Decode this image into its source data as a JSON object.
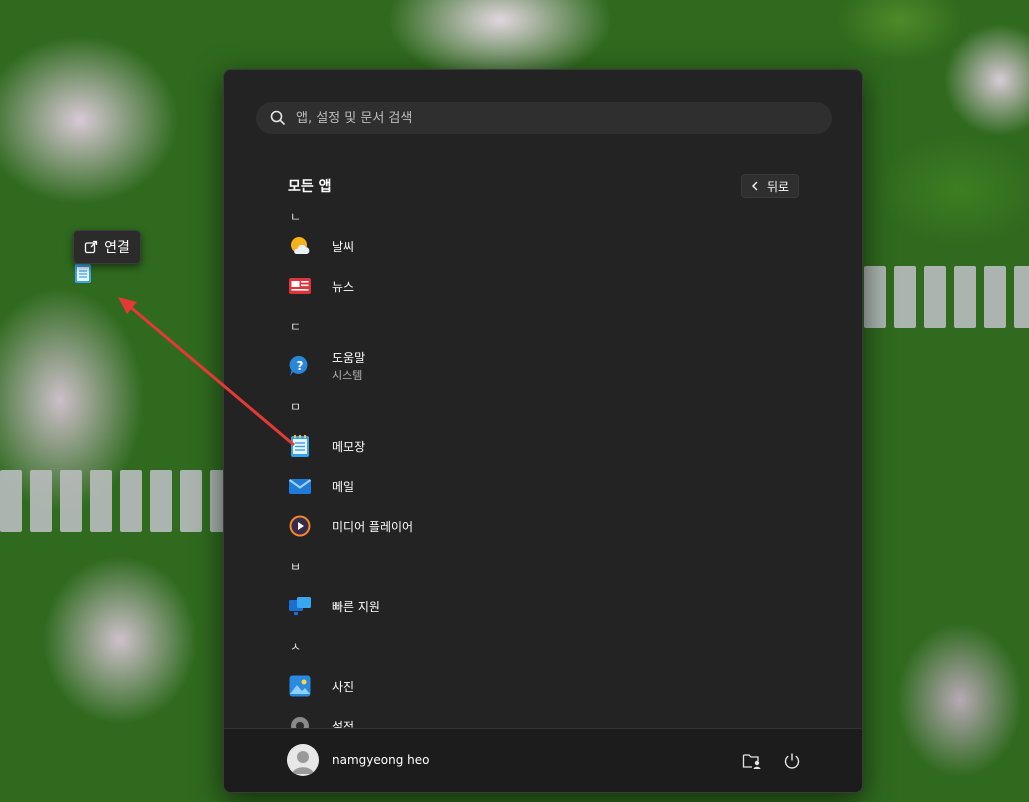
{
  "search": {
    "placeholder": "앱, 설정 및 문서 검색"
  },
  "all_apps": {
    "title": "모든 앱",
    "back_label": "뒤로"
  },
  "list": [
    {
      "kind": "letter",
      "label": "ㄴ"
    },
    {
      "kind": "app",
      "name": "날씨",
      "icon": "weather-icon"
    },
    {
      "kind": "app",
      "name": "뉴스",
      "icon": "news-icon"
    },
    {
      "kind": "letter",
      "label": "ㄷ"
    },
    {
      "kind": "app",
      "name": "도움말",
      "sub": "시스템",
      "icon": "help-icon"
    },
    {
      "kind": "letter",
      "label": "ㅁ"
    },
    {
      "kind": "app",
      "name": "메모장",
      "icon": "notepad-icon"
    },
    {
      "kind": "app",
      "name": "메일",
      "icon": "mail-icon"
    },
    {
      "kind": "app",
      "name": "미디어 플레이어",
      "icon": "media-player-icon"
    },
    {
      "kind": "letter",
      "label": "ㅂ"
    },
    {
      "kind": "app",
      "name": "빠른 지원",
      "icon": "quick-assist-icon"
    },
    {
      "kind": "letter",
      "label": "ㅅ"
    },
    {
      "kind": "app",
      "name": "사진",
      "icon": "photos-icon"
    },
    {
      "kind": "app",
      "name": "설정",
      "icon": "settings-icon"
    }
  ],
  "user": {
    "name": "namgyeong heo"
  },
  "tooltip": {
    "label": "연결"
  },
  "colors": {
    "menu_bg": "#232323",
    "footer_bg": "#1c1c1c",
    "arrow": "#e53935"
  }
}
